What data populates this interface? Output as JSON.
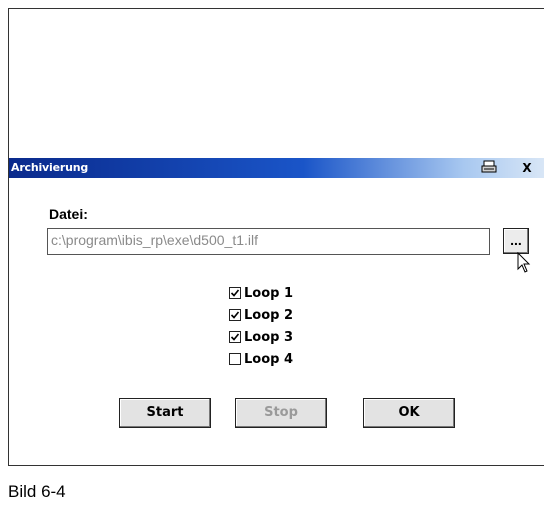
{
  "dialog": {
    "title": "Archivierung",
    "print_glyph": "🖨",
    "close_glyph": "X",
    "file_label": "Datei:",
    "file_path": "c:\\program\\ibis_rp\\exe\\d500_t1.ilf",
    "browse_label": "...",
    "loops": [
      {
        "label": "Loop 1",
        "checked": true
      },
      {
        "label": "Loop 2",
        "checked": true
      },
      {
        "label": "Loop 3",
        "checked": true
      },
      {
        "label": "Loop 4",
        "checked": false
      }
    ],
    "buttons": {
      "start": "Start",
      "stop": "Stop",
      "ok": "OK"
    }
  },
  "caption": "Bild 6-4",
  "colors": {
    "title_start": "#0a2a8c",
    "title_end": "#d8e6f6",
    "disabled_text": "#9a9a9a"
  },
  "icons": [
    "print-icon",
    "close-icon",
    "cursor-icon"
  ]
}
